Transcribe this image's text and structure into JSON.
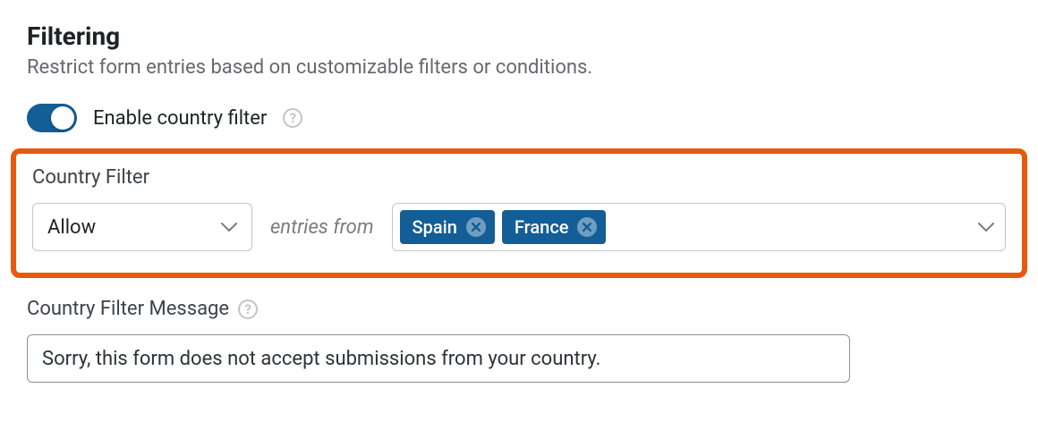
{
  "section": {
    "title": "Filtering",
    "description": "Restrict form entries based on customizable filters or conditions."
  },
  "enable_toggle": {
    "label": "Enable country filter",
    "state": "on"
  },
  "country_filter": {
    "label": "Country Filter",
    "action_select": {
      "value": "Allow"
    },
    "between_text": "entries from",
    "selected_countries": [
      "Spain",
      "France"
    ]
  },
  "message": {
    "label": "Country Filter Message",
    "value": "Sorry, this form does not accept submissions from your country."
  },
  "icons": {
    "help": "?"
  }
}
